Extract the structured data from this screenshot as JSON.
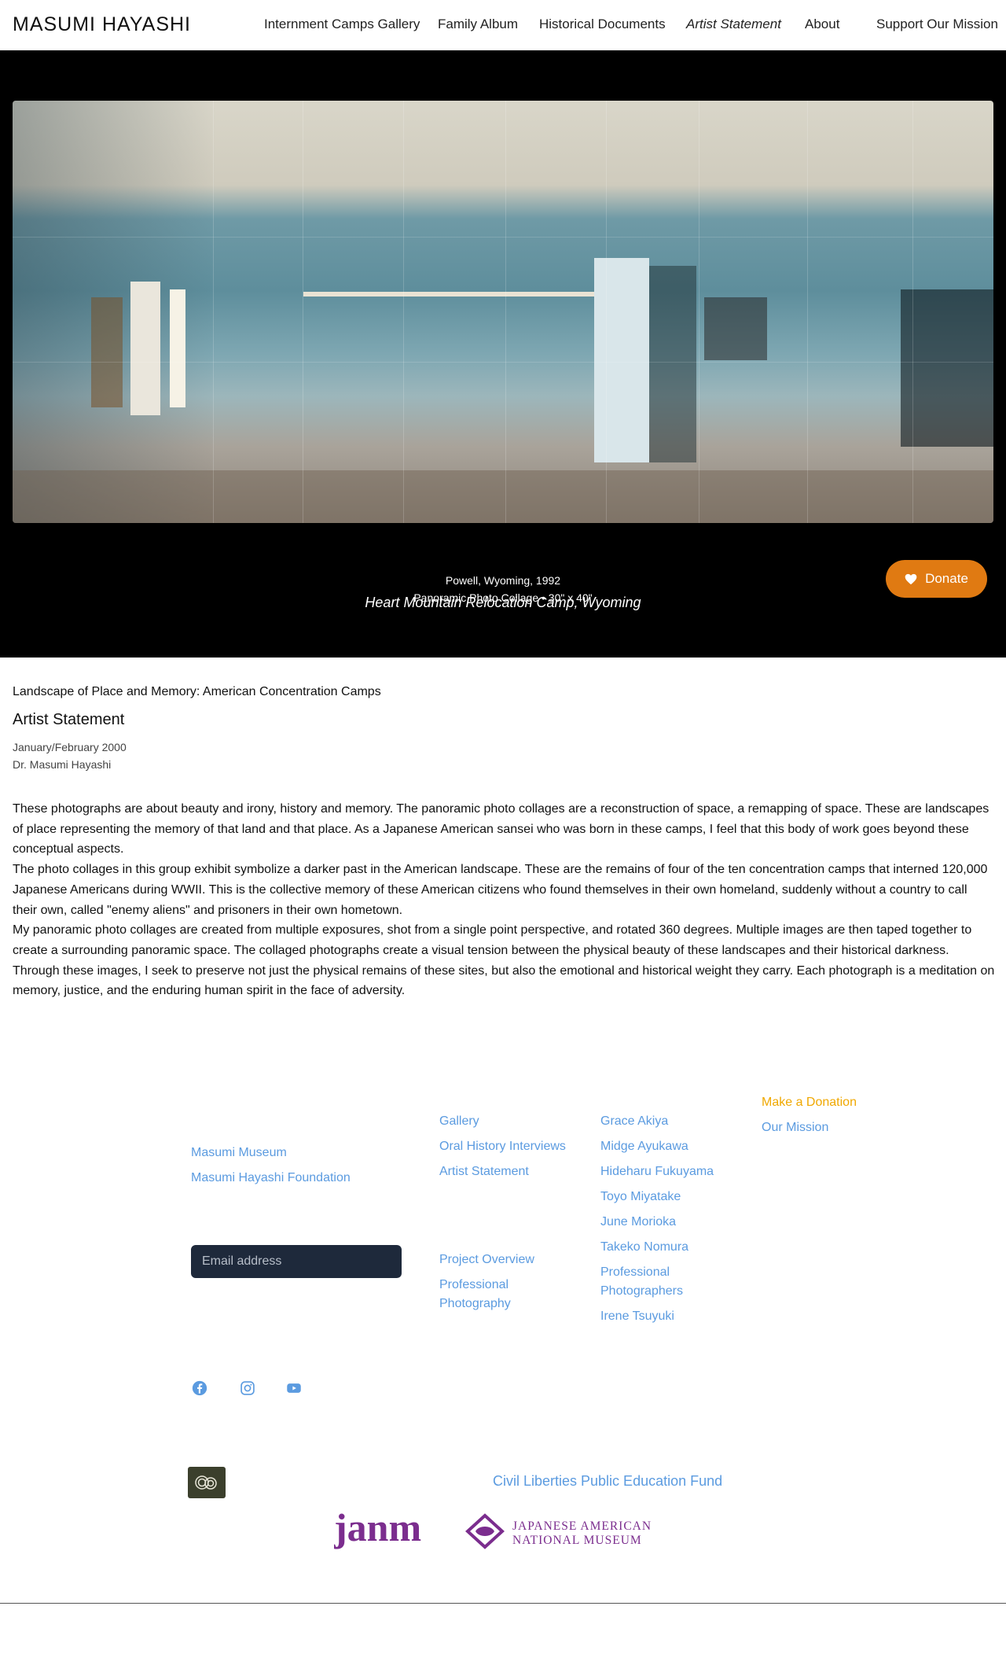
{
  "header": {
    "logo": "MASUMI HAYASHI",
    "nav": [
      "Internment Camps Gallery",
      "Family Album",
      "Historical Documents",
      "Artist Statement",
      "About"
    ],
    "support": "Support Our Mission"
  },
  "hero": {
    "donate_label": "Donate",
    "caption_title": "Heart Mountain Relocation Camp, Wyoming",
    "caption_line1": "Powell, Wyoming, 1992",
    "caption_line2": "Panoramic Photo Collage • 30\" x 40\""
  },
  "article": {
    "exhibit": "Landscape of Place and Memory: American Concentration Camps",
    "title": "Artist Statement",
    "date": "January/February 2000",
    "author": "Dr. Masumi Hayashi",
    "paragraphs": [
      "These photographs are about beauty and irony, history and memory. The panoramic photo collages are a reconstruction of space, a remapping of space. These are landscapes of place representing the memory of that land and that place. As a Japanese American sansei who was born in these camps, I feel that this body of work goes beyond these conceptual aspects.",
      "The photo collages in this group exhibit symbolize a darker past in the American landscape. These are the remains of four of the ten concentration camps that interned 120,000 Japanese Americans during WWII. This is the collective memory of these American citizens who found themselves in their own homeland, suddenly without a country to call their own, called \"enemy aliens\" and prisoners in their own hometown.",
      "My panoramic photo collages are created from multiple exposures, shot from a single point perspective, and rotated 360 degrees. Multiple images are then taped together to create a surrounding panoramic space. The collaged photographs create a visual tension between the physical beauty of these landscapes and their historical darkness. Through these images, I seek to preserve not just the physical remains of these sites, but also the emotional and historical weight they carry. Each photograph is a meditation on memory, justice, and the enduring human spirit in the face of adversity."
    ]
  },
  "footer": {
    "col1": [
      "Masumi Museum",
      "Masumi Hayashi Foundation"
    ],
    "email_placeholder": "Email address",
    "col2a": [
      "Gallery",
      "Oral History Interviews",
      "Artist Statement"
    ],
    "col2b": [
      "Project Overview",
      "Professional Photography"
    ],
    "col3": [
      "Grace Akiya",
      "Midge Ayukawa",
      "Hideharu Fukuyama",
      "Toyo Miyatake",
      "June Morioka",
      "Takeko Nomura",
      "Professional Photographers",
      "Irene Tsuyuki"
    ],
    "col4": [
      "Make a Donation",
      "Our Mission"
    ],
    "social_icons": [
      "facebook-icon",
      "instagram-icon",
      "youtube-icon"
    ],
    "clpef": "Civil Liberties Public Education Fund",
    "janm_mark": "janm",
    "janm_line1": "JAPANESE AMERICAN",
    "janm_line2": "NATIONAL MUSEUM",
    "accent": "#5b9be0",
    "donation_color": "#f0a800",
    "janm_color": "#7b2d8e"
  }
}
